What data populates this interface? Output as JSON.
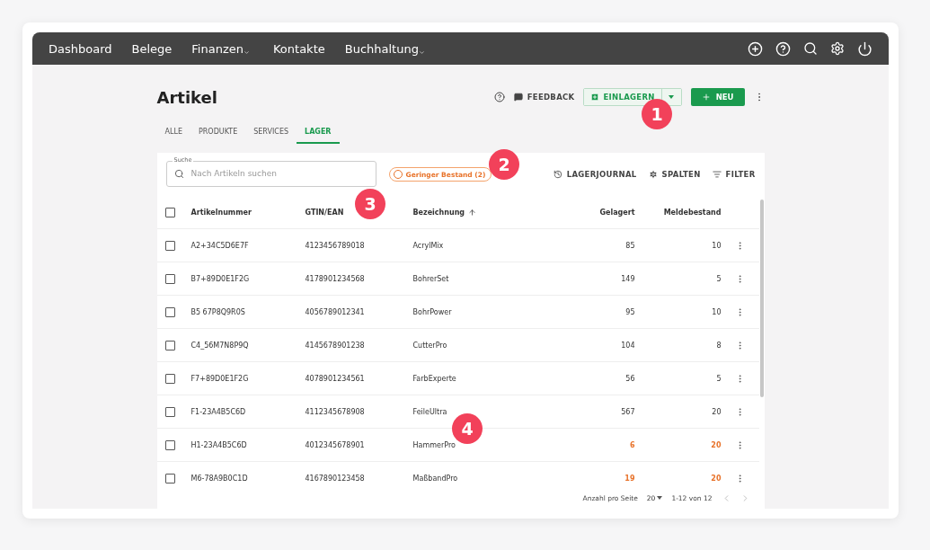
{
  "nav": {
    "items": [
      {
        "label": "Dashboard",
        "has_menu": false
      },
      {
        "label": "Belege",
        "has_menu": false
      },
      {
        "label": "Finanzen",
        "has_menu": true
      },
      {
        "label": "Kontakte",
        "has_menu": false
      },
      {
        "label": "Buchhaltung",
        "has_menu": true
      }
    ]
  },
  "page": {
    "title": "Artikel",
    "feedback": "FEEDBACK",
    "stock_in": "EINLAGERN",
    "new": "NEU"
  },
  "tabs": [
    {
      "label": "ALLE",
      "selected": false
    },
    {
      "label": "PRODUKTE",
      "selected": false
    },
    {
      "label": "SERVICES",
      "selected": false
    },
    {
      "label": "LAGER",
      "selected": true
    }
  ],
  "toolbar": {
    "search_label": "Suche",
    "search_placeholder": "Nach Artikeln suchen",
    "chip": "Geringer Bestand (2)",
    "chip_active": false,
    "actions": [
      "LAGERJOURNAL",
      "SPALTEN",
      "FILTER"
    ]
  },
  "table": {
    "columns": [
      "Artikelnummer",
      "GTIN/EAN",
      "Bezeichnung",
      "Gelagert",
      "Meldebestand"
    ],
    "all_checked": false,
    "rows": [
      {
        "number": "A2+34C5D6E7F",
        "gtin": "4123456789018",
        "name": "AcrylMix",
        "stock": "85",
        "min": "10",
        "low": false,
        "checked": false
      },
      {
        "number": "B7+89D0E1F2G",
        "gtin": "4178901234568",
        "name": "BohrerSet",
        "stock": "149",
        "min": "5",
        "low": false,
        "checked": false
      },
      {
        "number": "B5 67P8Q9R0S",
        "gtin": "4056789012341",
        "name": "BohrPower",
        "stock": "95",
        "min": "10",
        "low": false,
        "checked": false
      },
      {
        "number": "C4_56M7N8P9Q",
        "gtin": "4145678901238",
        "name": "CutterPro",
        "stock": "104",
        "min": "8",
        "low": false,
        "checked": false
      },
      {
        "number": "F7+89D0E1F2G",
        "gtin": "4078901234561",
        "name": "FarbExperte",
        "stock": "56",
        "min": "5",
        "low": false,
        "checked": false
      },
      {
        "number": "F1-23A4B5C6D",
        "gtin": "4112345678908",
        "name": "FeileUltra",
        "stock": "567",
        "min": "20",
        "low": false,
        "checked": false
      },
      {
        "number": "H1-23A4B5C6D",
        "gtin": "4012345678901",
        "name": "HammerPro",
        "stock": "6",
        "min": "20",
        "low": true,
        "checked": false
      },
      {
        "number": "M6-78A9B0C1D",
        "gtin": "4167890123458",
        "name": "MaßbandPro",
        "stock": "19",
        "min": "20",
        "low": true,
        "checked": false
      }
    ]
  },
  "pagination": {
    "per_page_label": "Anzahl pro Seite",
    "per_page": "20",
    "range": "1-12 von 12"
  },
  "markers": [
    "1",
    "2",
    "3",
    "4"
  ]
}
